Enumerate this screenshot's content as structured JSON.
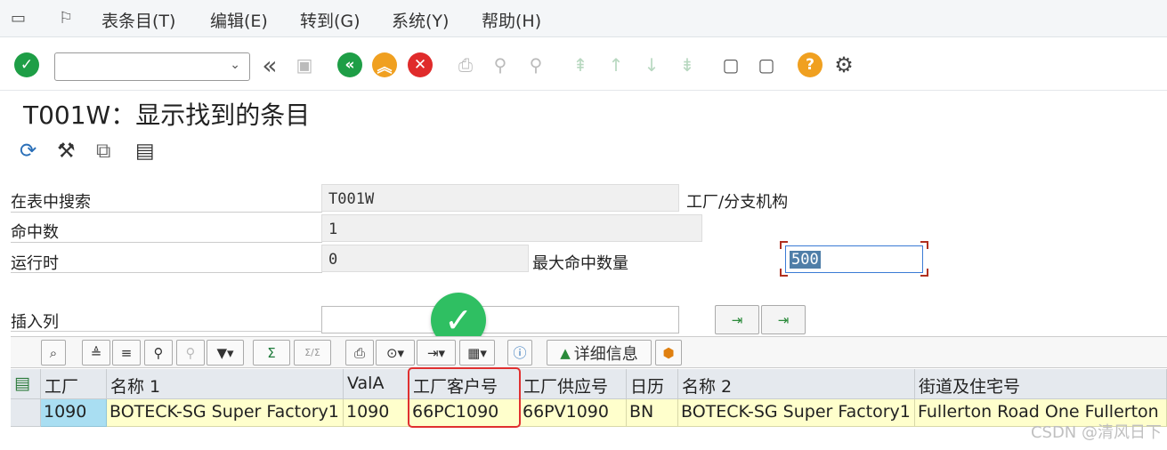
{
  "menu": {
    "items": [
      "表条目(T)",
      "编辑(E)",
      "转到(G)",
      "系统(Y)",
      "帮助(H)"
    ]
  },
  "toolbar": {
    "command_value": ""
  },
  "title": "T001W：显示找到的条目",
  "selection": {
    "search_table_label": "在表中搜索",
    "search_table_value": "T001W",
    "table_description": "工厂/分支机构",
    "hits_label": "命中数",
    "hits_value": "1",
    "runtime_label": "运行时",
    "runtime_value": "0",
    "max_hits_label": "最大命中数量",
    "max_hits_value": "500",
    "insert_column_label": "插入列",
    "insert_column_value": ""
  },
  "alv_toolbar": {
    "sum_label": "Σ",
    "subtotal_label": "Σ/Σ",
    "details_label": "详细信息"
  },
  "grid": {
    "headers": [
      "工厂",
      "名称 1",
      "ValA",
      "工厂客户号",
      "工厂供应号",
      "日历",
      "名称 2",
      "街道及住宅号"
    ],
    "rows": [
      [
        "1090",
        "BOTECK-SG Super Factory1",
        "1090",
        "66PC1090",
        "66PV1090",
        "BN",
        "BOTECK-SG Super Factory1",
        "Fullerton Road One Fullerton"
      ]
    ]
  },
  "watermark": "CSDN @清风日下",
  "colors": {
    "accent_green": "#1e9e46",
    "accent_orange": "#f0a020",
    "accent_red": "#e02b2b",
    "data_cell_bg": "#ffffcc",
    "key_cell_bg": "#a9def2",
    "highlight_red": "#e03030"
  }
}
